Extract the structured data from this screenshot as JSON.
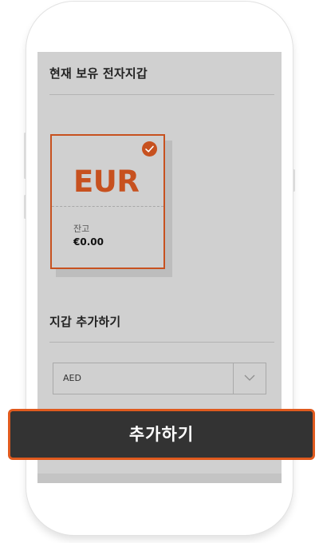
{
  "wallets_section": {
    "title": "현재 보유 전자지갑",
    "selected_wallet": {
      "currency": "EUR",
      "balance_label": "잔고",
      "balance": "€0.00",
      "selected": true
    }
  },
  "add_section": {
    "title": "지갑 추가하기",
    "select": {
      "value": "AED"
    }
  },
  "action": {
    "add_label": "추가하기"
  },
  "colors": {
    "accent": "#c7511f",
    "button_border": "#e05a1e",
    "button_bg": "#333333",
    "screen_bg": "#d0d0d0"
  },
  "icons": [
    "check-circle-icon",
    "chevron-down-icon"
  ]
}
